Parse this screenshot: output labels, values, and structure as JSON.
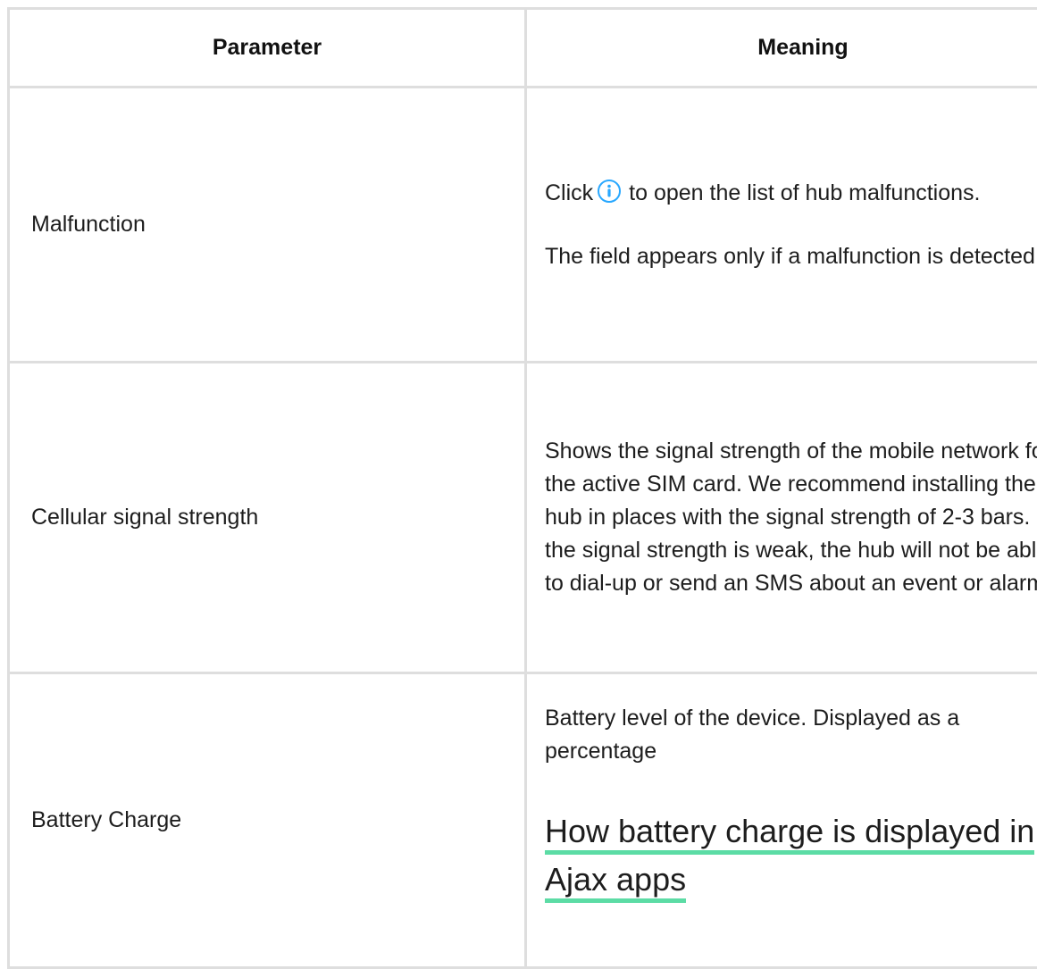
{
  "header": {
    "param_label": "Parameter",
    "meaning_label": "Meaning"
  },
  "rows": [
    {
      "param": "Malfunction",
      "meaning_p1_before": "Click",
      "meaning_p1_icon": "info-icon",
      "meaning_p1_after": "to open the list of hub malfunctions.",
      "meaning_p2": "The field appears only if a malfunction is detected"
    },
    {
      "param": "Cellular signal strength",
      "meaning": "Shows the signal strength of the mobile network for the active SIM card. We recommend installing the hub in places with the signal strength of 2-3 bars. If the signal strength is weak, the hub will not be able to dial-up or send an SMS about an event or alarm"
    },
    {
      "param": "Battery Charge",
      "meaning": "Battery level of the device. Displayed as a percentage",
      "link": "How battery charge is displayed in Ajax apps"
    }
  ],
  "colors": {
    "border": "#dedede",
    "icon_accent": "#29a8ff",
    "link_underline": "#5cdca5"
  }
}
